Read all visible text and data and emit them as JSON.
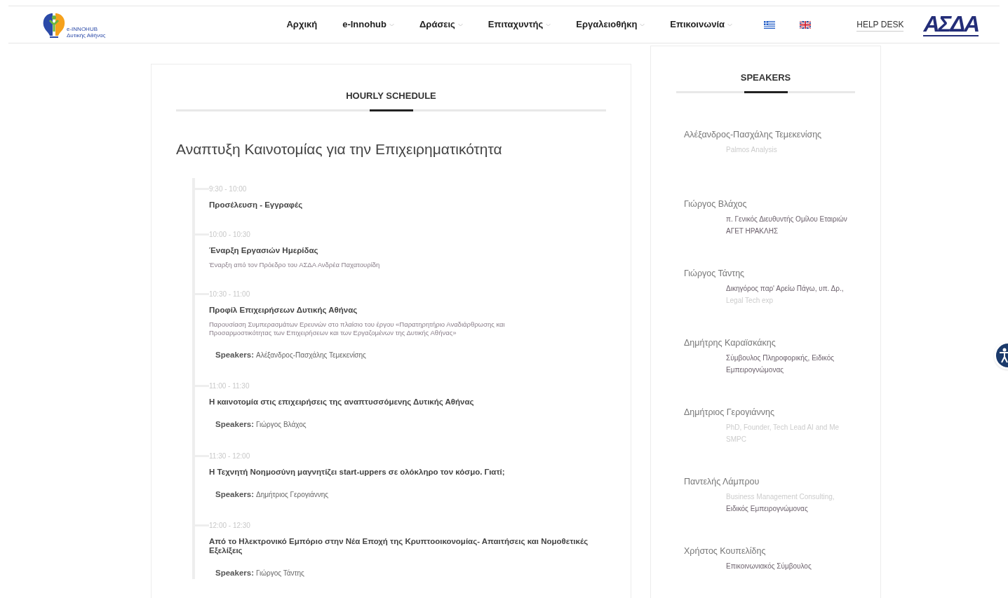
{
  "header": {
    "logo_lines": [
      "e-INNOHUB",
      "Δυτικής Αθήνας"
    ],
    "nav": [
      {
        "label": "Αρχική",
        "dropdown": false
      },
      {
        "label": "e-Innohub",
        "dropdown": true
      },
      {
        "label": "Δράσεις",
        "dropdown": true
      },
      {
        "label": "Επιταχυντής",
        "dropdown": true
      },
      {
        "label": "Εργαλειοθήκη",
        "dropdown": true
      },
      {
        "label": "Επικοινωνία",
        "dropdown": true
      }
    ],
    "languages": [
      {
        "kind": "greece"
      },
      {
        "kind": "uk"
      }
    ],
    "help_desk": "HELP DESK",
    "partner_logo": "ΑΣΔΑ"
  },
  "schedule": {
    "tab": "HOURLY SCHEDULE",
    "title": "Αναπτυξη Καινοτομίας για την Επιχειρηματικότητα",
    "items": [
      {
        "time": "9:30 - 10:00",
        "title": "Προσέλευση - Εγγραφές"
      },
      {
        "time": "10:00 - 10:30",
        "title": "Έναρξη Εργασιών Ημερίδας",
        "description": "Έναρξη από τον Πρόεδρο του ΑΣΔΑ Ανδρέα Παχατουρίδη"
      },
      {
        "time": "10:30 - 11:00",
        "title": "Προφίλ Επιχειρήσεων Δυτικής Αθήνας",
        "description": "Παρουσίαση Συμπερασμάτων Ερευνών στο πλαίσιο του έργου «Παρατηρητήριο Αναδιάρθρωσης και Προσαρμοστικότητας των Επιχειρήσεων και των Εργαζομένων της Δυτικής Αθήνας»",
        "speakers": {
          "label": "Speakers:",
          "names": "Αλέξανδρος-Πασχάλης Τεμεκενίσης"
        }
      },
      {
        "time": "11:00 - 11:30",
        "title": "Η καινοτομία στις επιχειρήσεις της αναπτυσσόμενης Δυτικής Αθήνας",
        "speakers": {
          "label": "Speakers:",
          "names": "Γιώργος Βλάχος"
        }
      },
      {
        "time": "11:30 - 12:00",
        "title": "Η Τεχνητή Νοημοσύνη μαγνητίζει start-uppers σε ολόκληρο τον κόσμο. Γιατί;",
        "speakers": {
          "label": "Speakers:",
          "names": "Δημήτριος Γερογιάννης"
        }
      },
      {
        "time": "12:00 - 12:30",
        "title": "Από το Ηλεκτρονικό Εμπόριο στην Νέα Εποχή της Κρυπτοοικονομίας- Απαιτήσεις και Νομοθετικές Εξελίξεις",
        "speakers": {
          "label": "Speakers:",
          "names": "Γιώργος Τάντης"
        }
      }
    ]
  },
  "speakers": {
    "tab": "SPEAKERS",
    "items": [
      {
        "name": "Αλέξανδρος-Πασχάλης Τεμεκενίσης",
        "role": [
          {
            "text": "Palmos Analysis",
            "muted": true
          }
        ]
      },
      {
        "name": "Γιώργος Βλάχος",
        "role": [
          {
            "text": "π. Γενικός Διευθυντής Ομίλου Εταιριών ΑΓΕΤ ΗΡΑΚΛΗΣ",
            "muted": false
          }
        ]
      },
      {
        "name": "Γιώργος Τάντης",
        "role": [
          {
            "text": "Δικηγόρος παρ' Αρείω Πάγω, υπ. Δρ.,",
            "muted": false
          },
          {
            "text": "Legal Tech exp",
            "muted": true
          }
        ]
      },
      {
        "name": "Δημήτρης Καραϊσκάκης",
        "role": [
          {
            "text": "Σύμβουλος Πληροφορικής, Ειδικός Εμπειρογνώμονας",
            "muted": false
          }
        ]
      },
      {
        "name": "Δημήτριος Γερογιάννης",
        "role": [
          {
            "text": "PhD, Founder, Tech Lead AI and Me SMPC",
            "muted": true
          }
        ]
      },
      {
        "name": "Παντελής Λάμπρου",
        "role": [
          {
            "text": "Business Management Consulting,",
            "muted": true
          },
          {
            "text": "Ειδικός Εμπειρογνώμονας",
            "muted": false
          }
        ]
      },
      {
        "name": "Χρήστος Κουπελίδης",
        "role": [
          {
            "text": "Επικοινωνιακός Σύμβουλος",
            "muted": false
          }
        ]
      }
    ]
  }
}
